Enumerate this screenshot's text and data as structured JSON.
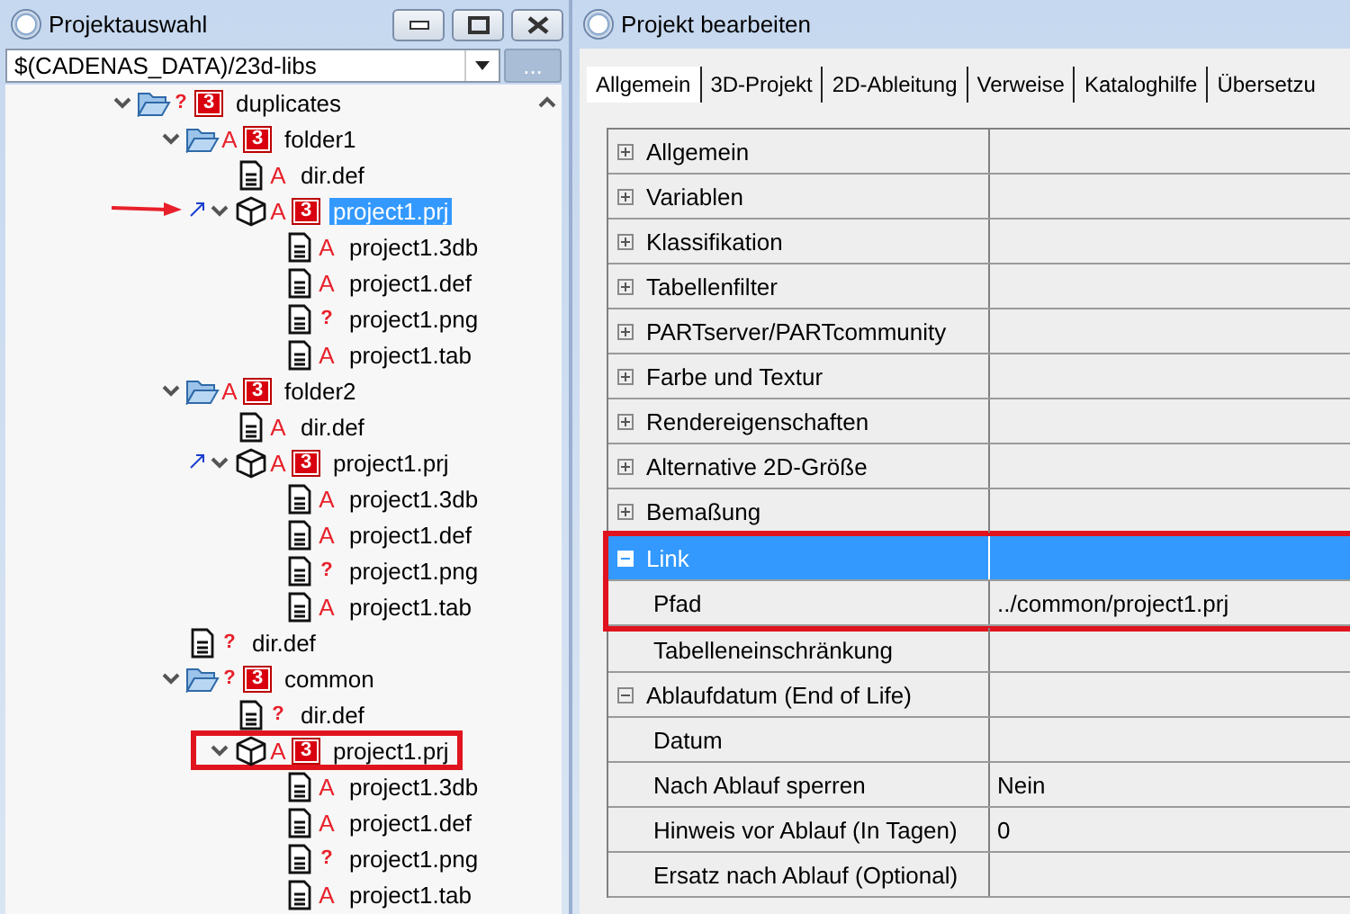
{
  "left_window": {
    "title": "Projektauswahl",
    "path_combo": {
      "value": "$(CADENAS_DATA)/23d-libs"
    },
    "browse_button": "...",
    "tree": [
      {
        "name": "duplicates",
        "kind": "folder",
        "status": "?",
        "badge": "3",
        "expanded": true,
        "selected": false,
        "children": [
          {
            "name": "folder1",
            "kind": "folder",
            "status": "A",
            "badge": "3",
            "expanded": true,
            "selected": false,
            "children": [
              {
                "name": "dir.def",
                "kind": "file",
                "status": "A",
                "selected": false
              },
              {
                "name": "project1.prj",
                "kind": "project",
                "status": "A",
                "badge": "3",
                "expanded": true,
                "selected": true,
                "linked": true,
                "highlighted": false,
                "annotated": true,
                "children": [
                  {
                    "name": "project1.3db",
                    "kind": "file",
                    "status": "A",
                    "selected": false
                  },
                  {
                    "name": "project1.def",
                    "kind": "file",
                    "status": "A",
                    "selected": false
                  },
                  {
                    "name": "project1.png",
                    "kind": "file",
                    "status": "?",
                    "selected": false
                  },
                  {
                    "name": "project1.tab",
                    "kind": "file",
                    "status": "A",
                    "selected": false
                  }
                ]
              }
            ]
          },
          {
            "name": "folder2",
            "kind": "folder",
            "status": "A",
            "badge": "3",
            "expanded": true,
            "selected": false,
            "children": [
              {
                "name": "dir.def",
                "kind": "file",
                "status": "A",
                "selected": false
              },
              {
                "name": "project1.prj",
                "kind": "project",
                "status": "A",
                "badge": "3",
                "expanded": true,
                "selected": false,
                "linked": true,
                "highlighted": false,
                "annotated": false,
                "children": [
                  {
                    "name": "project1.3db",
                    "kind": "file",
                    "status": "A",
                    "selected": false
                  },
                  {
                    "name": "project1.def",
                    "kind": "file",
                    "status": "A",
                    "selected": false
                  },
                  {
                    "name": "project1.png",
                    "kind": "file",
                    "status": "?",
                    "selected": false
                  },
                  {
                    "name": "project1.tab",
                    "kind": "file",
                    "status": "A",
                    "selected": false
                  }
                ]
              }
            ]
          },
          {
            "name": "dir.def",
            "kind": "file",
            "status": "?",
            "selected": false
          },
          {
            "name": "common",
            "kind": "folder",
            "status": "?",
            "badge": "3",
            "expanded": true,
            "selected": false,
            "children": [
              {
                "name": "dir.def",
                "kind": "file",
                "status": "?",
                "selected": false
              },
              {
                "name": "project1.prj",
                "kind": "project",
                "status": "A",
                "badge": "3",
                "expanded": true,
                "selected": false,
                "linked": false,
                "highlighted": true,
                "annotated": false,
                "children": [
                  {
                    "name": "project1.3db",
                    "kind": "file",
                    "status": "A",
                    "selected": false
                  },
                  {
                    "name": "project1.def",
                    "kind": "file",
                    "status": "A",
                    "selected": false
                  },
                  {
                    "name": "project1.png",
                    "kind": "file",
                    "status": "?",
                    "selected": false
                  },
                  {
                    "name": "project1.tab",
                    "kind": "file",
                    "status": "A",
                    "selected": false
                  }
                ]
              }
            ]
          }
        ]
      }
    ]
  },
  "right_window": {
    "title": "Projekt bearbeiten",
    "tabs": [
      {
        "label": "Allgemein",
        "selected": true
      },
      {
        "label": "3D-Projekt",
        "selected": false
      },
      {
        "label": "2D-Ableitung",
        "selected": false
      },
      {
        "label": "Verweise",
        "selected": false
      },
      {
        "label": "Kataloghilfe",
        "selected": false
      },
      {
        "label": "Übersetzu",
        "selected": false
      }
    ],
    "properties": [
      {
        "kind": "group",
        "name": "Allgemein",
        "expanded": false,
        "selected": false,
        "highlighted": false
      },
      {
        "kind": "group",
        "name": "Variablen",
        "expanded": false,
        "selected": false,
        "highlighted": false
      },
      {
        "kind": "group",
        "name": "Klassifikation",
        "expanded": false,
        "selected": false,
        "highlighted": false
      },
      {
        "kind": "group",
        "name": "Tabellenfilter",
        "expanded": false,
        "selected": false,
        "highlighted": false
      },
      {
        "kind": "group",
        "name": "PARTserver/PARTcommunity",
        "expanded": false,
        "selected": false,
        "highlighted": false
      },
      {
        "kind": "group",
        "name": "Farbe und Textur",
        "expanded": false,
        "selected": false,
        "highlighted": false
      },
      {
        "kind": "group",
        "name": "Rendereigenschaften",
        "expanded": false,
        "selected": false,
        "highlighted": false
      },
      {
        "kind": "group",
        "name": "Alternative 2D-Größe",
        "expanded": false,
        "selected": false,
        "highlighted": false
      },
      {
        "kind": "group",
        "name": "Bemaßung",
        "expanded": false,
        "selected": false,
        "highlighted": false
      },
      {
        "kind": "group",
        "name": "Link",
        "expanded": true,
        "selected": true,
        "highlighted": true
      },
      {
        "kind": "property",
        "name": "Pfad",
        "value": "../common/project1.prj",
        "selected": false,
        "highlighted": true
      },
      {
        "kind": "property",
        "name": "Tabelleneinschränkung",
        "selected": false,
        "highlighted": false
      },
      {
        "kind": "group",
        "name": "Ablaufdatum (End of Life)",
        "expanded": true,
        "selected": false,
        "highlighted": false
      },
      {
        "kind": "property",
        "name": "Datum",
        "selected": false,
        "highlighted": false
      },
      {
        "kind": "property",
        "name": "Nach Ablauf sperren",
        "value": "Nein",
        "selected": false,
        "highlighted": false
      },
      {
        "kind": "property",
        "name": "Hinweis vor Ablauf (In Tagen)",
        "value": "0",
        "selected": false,
        "highlighted": false
      },
      {
        "kind": "property",
        "name": "Ersatz nach Ablauf (Optional)",
        "selected": false,
        "highlighted": false
      }
    ]
  }
}
